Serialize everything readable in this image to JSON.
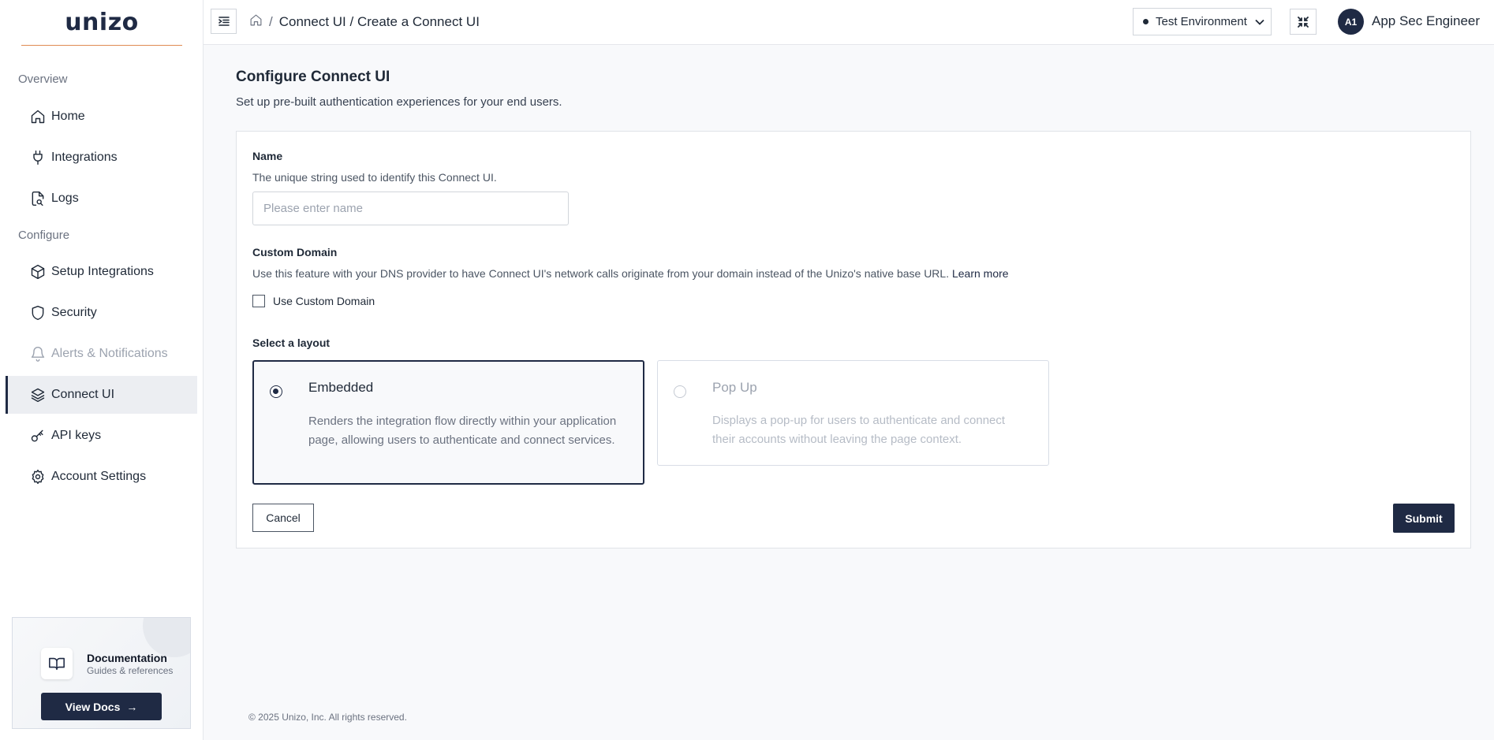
{
  "brand": {
    "logo": "unizo",
    "accent": "#e08a52",
    "primary": "#1f2a44"
  },
  "sidebar": {
    "sections": [
      {
        "label": "Overview"
      },
      {
        "label": "Configure"
      }
    ],
    "items": [
      {
        "label": "Home",
        "icon": "home-icon"
      },
      {
        "label": "Integrations",
        "icon": "plug-icon"
      },
      {
        "label": "Logs",
        "icon": "file-search-icon"
      },
      {
        "label": "Setup Integrations",
        "icon": "box-icon"
      },
      {
        "label": "Security",
        "icon": "shield-icon"
      },
      {
        "label": "Alerts & Notifications",
        "icon": "bell-icon",
        "disabled": true
      },
      {
        "label": "Connect UI",
        "icon": "layers-icon",
        "active": true
      },
      {
        "label": "API keys",
        "icon": "key-icon"
      },
      {
        "label": "Account Settings",
        "icon": "gear-icon"
      }
    ],
    "docs": {
      "title": "Documentation",
      "subtitle": "Guides & references",
      "button": "View Docs"
    }
  },
  "header": {
    "breadcrumb": "Connect UI / Create a Connect UI",
    "environment": "Test Environment",
    "user": {
      "initials": "A1",
      "name": "App Sec Engineer"
    }
  },
  "main": {
    "title": "Configure Connect UI",
    "subtitle": "Set up pre-built authentication experiences for your end users.",
    "form": {
      "name_label": "Name",
      "name_help": "The unique string used to identify this Connect UI.",
      "name_placeholder": "Please enter name",
      "name_value": "",
      "domain_label": "Custom Domain",
      "domain_help": "Use this feature with your DNS provider to have Connect UI's network calls originate from your domain instead of the Unizo's native base URL.",
      "learn_more": "Learn more",
      "use_custom_domain": "Use Custom Domain",
      "use_custom_domain_checked": false,
      "layout_label": "Select a layout",
      "layouts": [
        {
          "title": "Embedded",
          "description": "Renders the integration flow directly within your application page, allowing users to authenticate and connect services.",
          "selected": true
        },
        {
          "title": "Pop Up",
          "description": "Displays a pop-up for users to authenticate and connect their accounts without leaving the page context.",
          "selected": false
        }
      ],
      "cancel": "Cancel",
      "submit": "Submit"
    }
  },
  "footer": {
    "copyright": "© 2025 Unizo, Inc. All rights reserved."
  }
}
